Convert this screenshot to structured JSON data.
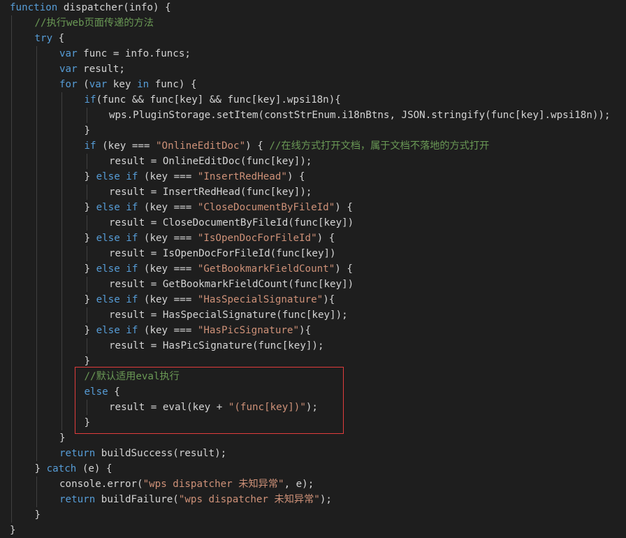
{
  "editor": {
    "background": "#1e1e1e",
    "annotation_color": "#e03c3c",
    "token_colors": {
      "keyword": "#569cd6",
      "string": "#ce9178",
      "comment": "#6a9955",
      "plain": "#d4d4d4"
    },
    "lines": [
      [
        [
          "kw",
          "function"
        ],
        [
          "pl",
          " dispatcher(info) {"
        ]
      ],
      [
        [
          "cm",
          "//执行web页面传递的方法"
        ]
      ],
      [
        [
          "kw",
          "try"
        ],
        [
          "pl",
          " {"
        ]
      ],
      [
        [
          "kw",
          "var"
        ],
        [
          "pl",
          " func = info.funcs;"
        ]
      ],
      [
        [
          "kw",
          "var"
        ],
        [
          "pl",
          " result;"
        ]
      ],
      [
        [
          "kw",
          "for"
        ],
        [
          "pl",
          " ("
        ],
        [
          "kw",
          "var"
        ],
        [
          "pl",
          " key "
        ],
        [
          "kw",
          "in"
        ],
        [
          "pl",
          " func) {"
        ]
      ],
      [
        [
          "kw",
          "if"
        ],
        [
          "pl",
          "(func && func[key] && func[key].wpsi18n){"
        ]
      ],
      [
        [
          "pl",
          "wps.PluginStorage.setItem(constStrEnum.i18nBtns, JSON.stringify(func[key].wpsi18n));"
        ]
      ],
      [
        [
          "pl",
          "}"
        ]
      ],
      [
        [
          "kw",
          "if"
        ],
        [
          "pl",
          " (key === "
        ],
        [
          "str",
          "\"OnlineEditDoc\""
        ],
        [
          "pl",
          ") { "
        ],
        [
          "cm",
          "//在线方式打开文档，属于文档不落地的方式打开"
        ]
      ],
      [
        [
          "pl",
          "result = OnlineEditDoc(func[key]);"
        ]
      ],
      [
        [
          "pl",
          "} "
        ],
        [
          "kw",
          "else if"
        ],
        [
          "pl",
          " (key === "
        ],
        [
          "str",
          "\"InsertRedHead\""
        ],
        [
          "pl",
          ") {"
        ]
      ],
      [
        [
          "pl",
          "result = InsertRedHead(func[key]);"
        ]
      ],
      [
        [
          "pl",
          "} "
        ],
        [
          "kw",
          "else if"
        ],
        [
          "pl",
          " (key === "
        ],
        [
          "str",
          "\"CloseDocumentByFileId\""
        ],
        [
          "pl",
          ") {"
        ]
      ],
      [
        [
          "pl",
          "result = CloseDocumentByFileId(func[key])"
        ]
      ],
      [
        [
          "pl",
          "} "
        ],
        [
          "kw",
          "else if"
        ],
        [
          "pl",
          " (key === "
        ],
        [
          "str",
          "\"IsOpenDocForFileId\""
        ],
        [
          "pl",
          ") {"
        ]
      ],
      [
        [
          "pl",
          "result = IsOpenDocForFileId(func[key])"
        ]
      ],
      [
        [
          "pl",
          "} "
        ],
        [
          "kw",
          "else if"
        ],
        [
          "pl",
          " (key === "
        ],
        [
          "str",
          "\"GetBookmarkFieldCount\""
        ],
        [
          "pl",
          ") {"
        ]
      ],
      [
        [
          "pl",
          "result = GetBookmarkFieldCount(func[key])"
        ]
      ],
      [
        [
          "pl",
          "} "
        ],
        [
          "kw",
          "else if"
        ],
        [
          "pl",
          " (key === "
        ],
        [
          "str",
          "\"HasSpecialSignature\""
        ],
        [
          "pl",
          "){"
        ]
      ],
      [
        [
          "pl",
          "result = HasSpecialSignature(func[key]);"
        ]
      ],
      [
        [
          "pl",
          "} "
        ],
        [
          "kw",
          "else if"
        ],
        [
          "pl",
          " (key === "
        ],
        [
          "str",
          "\"HasPicSignature\""
        ],
        [
          "pl",
          "){"
        ]
      ],
      [
        [
          "pl",
          "result = HasPicSignature(func[key]);"
        ]
      ],
      [
        [
          "pl",
          "}"
        ]
      ],
      [
        [
          "cm",
          "//默认适用eval执行"
        ]
      ],
      [
        [
          "kw",
          "else"
        ],
        [
          "pl",
          " {"
        ]
      ],
      [
        [
          "pl",
          "result = eval(key + "
        ],
        [
          "str",
          "\"(func[key])\""
        ],
        [
          "pl",
          ");"
        ]
      ],
      [
        [
          "pl",
          "}"
        ]
      ],
      [
        [
          "pl",
          "}"
        ]
      ],
      [
        [
          "kw",
          "return"
        ],
        [
          "pl",
          " buildSuccess(result);"
        ]
      ],
      [
        [
          "pl",
          "} "
        ],
        [
          "kw",
          "catch"
        ],
        [
          "pl",
          " (e) {"
        ]
      ],
      [
        [
          "pl",
          "console.error("
        ],
        [
          "str",
          "\"wps dispatcher 未知异常\""
        ],
        [
          "pl",
          ", e);"
        ]
      ],
      [
        [
          "kw",
          "return"
        ],
        [
          "pl",
          " buildFailure("
        ],
        [
          "str",
          "\"wps dispatcher 未知异常\""
        ],
        [
          "pl",
          ");"
        ]
      ],
      [
        [
          "pl",
          "}"
        ]
      ],
      [
        [
          "pl",
          "}"
        ]
      ]
    ]
  }
}
